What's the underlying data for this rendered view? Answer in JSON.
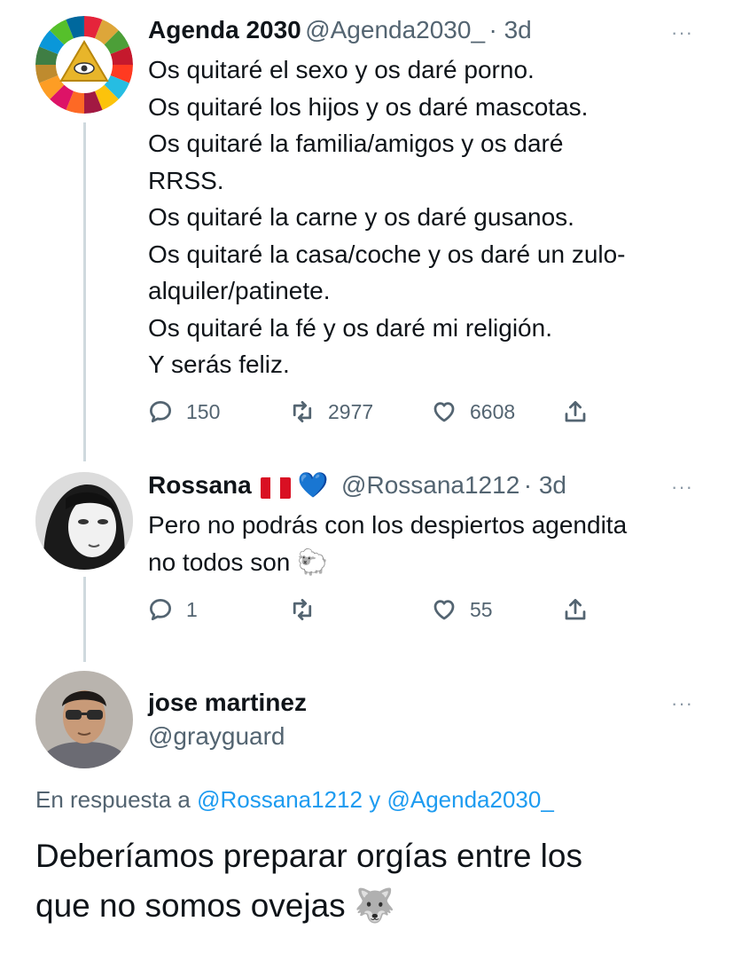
{
  "tweet1": {
    "name": "Agenda 2030",
    "handle": "@Agenda2030_",
    "time": "· 3d",
    "more": "···",
    "lines": [
      "Os quitaré el sexo y os daré porno.",
      "Os quitaré los hijos y os daré mascotas.",
      "Os quitaré la familia/amigos y os daré",
      "RRSS.",
      "Os quitaré la carne y os daré gusanos.",
      "Os quitaré la casa/coche y os daré un zulo-",
      "alquiler/patinete.",
      "Os quitaré la fé y os daré mi religión.",
      "Y serás feliz."
    ],
    "replies": "150",
    "retweets": "2977",
    "likes": "6608",
    "avatar_icon": "eye-of-providence-sdg-wheel-icon"
  },
  "tweet2": {
    "name": "Rossana",
    "handle": "@Rossana1212",
    "time": "· 3d",
    "more": "···",
    "emoji_flag": "peru-flag-icon",
    "emoji_heart": "💙",
    "lines": [
      "Pero no podrás con los despiertos agendita",
      "no todos son 🐑"
    ],
    "replies": "1",
    "retweets": "",
    "likes": "55"
  },
  "tweet3": {
    "name": "jose martinez",
    "handle": "@grayguard",
    "more": "···",
    "reply_prefix": "En respuesta a",
    "reply_user1": "@Rossana1212",
    "reply_and": "y",
    "reply_user2": "@Agenda2030_",
    "lines": [
      "Deberíamos preparar orgías entre los",
      "que no somos ovejas 🐺"
    ]
  },
  "colors": {
    "text": "#0f1419",
    "secondary": "#536471",
    "link": "#1d9bf0",
    "thread_line": "#cfd9de"
  }
}
